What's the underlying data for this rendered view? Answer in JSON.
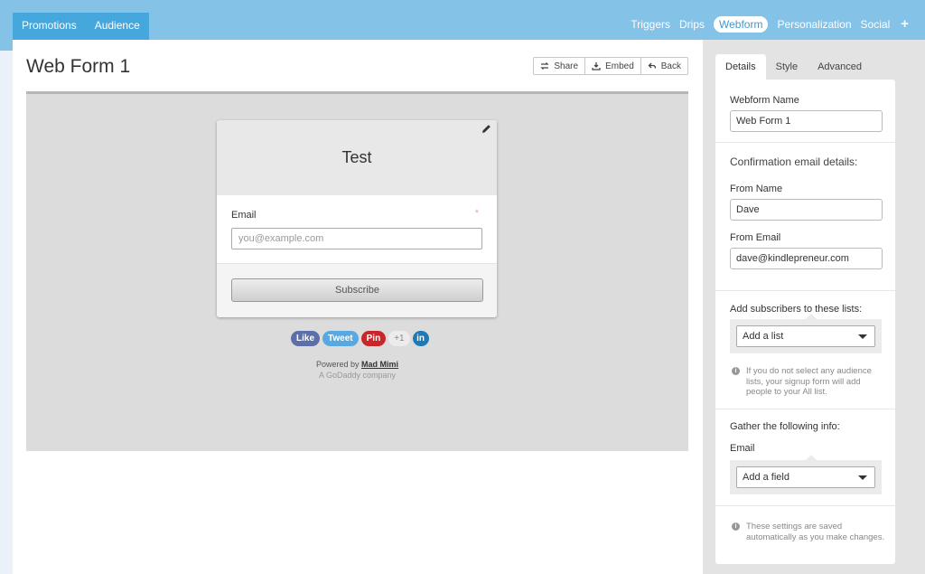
{
  "topnav": {
    "left_tabs": [
      "Promotions",
      "Audience"
    ],
    "right_items": [
      "Triggers",
      "Drips",
      "Webform",
      "Personalization",
      "Social"
    ],
    "active_item": "Webform",
    "plus_label": "+"
  },
  "main": {
    "title": "Web Form 1",
    "actions": {
      "share": "Share",
      "embed": "Embed",
      "back": "Back"
    }
  },
  "preview": {
    "form_title": "Test",
    "email_label": "Email",
    "required_mark": "*",
    "email_placeholder": "you@example.com",
    "subscribe_label": "Subscribe",
    "social": {
      "like": "Like",
      "tweet": "Tweet",
      "pin": "Pin",
      "plus_one": "+1",
      "linkedin": "in"
    },
    "powered_by_prefix": "Powered by",
    "powered_by_brand": "Mad Mimi",
    "company": "A GoDaddy company"
  },
  "side": {
    "tabs": [
      "Details",
      "Style",
      "Advanced"
    ],
    "active_tab": "Details",
    "webform_name_label": "Webform Name",
    "webform_name_value": "Web Form 1",
    "confirm_heading": "Confirmation email details:",
    "from_name_label": "From Name",
    "from_name_value": "Dave",
    "from_email_label": "From Email",
    "from_email_value": "dave@kindlepreneur.com",
    "lists_label": "Add subscribers to these lists:",
    "add_list": "Add a list",
    "lists_info": "If you do not select any audience lists, your signup form will add people to your All list.",
    "gather_label": "Gather the following info:",
    "gather_email": "Email",
    "add_field": "Add a field",
    "saved_info": "These settings are saved automatically as you make changes."
  },
  "colors": {
    "nav_bg": "#84c2e8",
    "nav_tab_bg": "#45a7dc",
    "preview_bg": "#dcdcdc",
    "side_bg": "#e3e3e3"
  }
}
